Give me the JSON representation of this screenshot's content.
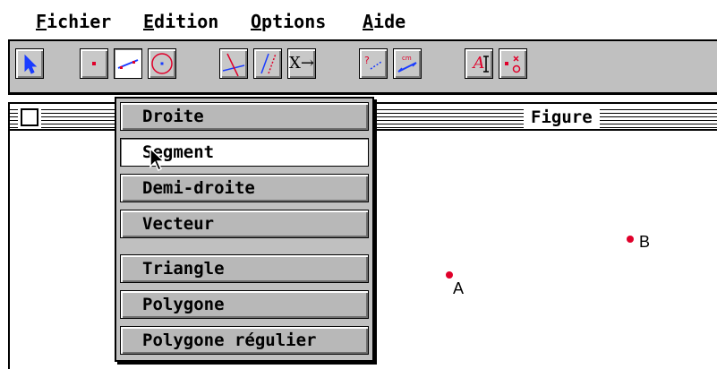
{
  "menubar": {
    "items": [
      {
        "accel": "F",
        "rest": "ichier"
      },
      {
        "accel": "E",
        "rest": "dition"
      },
      {
        "accel": "O",
        "rest": "ptions"
      },
      {
        "accel": "A",
        "rest": "ide"
      }
    ]
  },
  "toolbar": {
    "tools": [
      {
        "name": "pointer",
        "icon": "arrow-pointer-icon"
      },
      {
        "name": "point",
        "icon": "point-icon"
      },
      {
        "name": "line",
        "icon": "line-icon",
        "pressed": true
      },
      {
        "name": "circle",
        "icon": "circle-icon"
      },
      {
        "name": "perpendicular",
        "icon": "perpendicular-icon"
      },
      {
        "name": "parallel",
        "icon": "parallel-icon"
      },
      {
        "name": "transform",
        "icon": "transform-icon",
        "text": "X→"
      },
      {
        "name": "measure",
        "icon": "measure-icon"
      },
      {
        "name": "distance",
        "icon": "distance-icon"
      },
      {
        "name": "text",
        "icon": "text-icon",
        "text": "A"
      },
      {
        "name": "delete",
        "icon": "delete-icon"
      }
    ]
  },
  "window": {
    "title": "Figure"
  },
  "dropdown": {
    "items": [
      "Droite",
      "Segment",
      "Demi-droite",
      "Vecteur",
      "Triangle",
      "Polygone",
      "Polygone régulier"
    ],
    "highlighted_index": 1
  },
  "points": [
    {
      "label": "A"
    },
    {
      "label": "B"
    }
  ],
  "colors": {
    "accent_red": "#e0002a",
    "tool_blue": "#1a3cff",
    "toolbar_gray": "#c0c0c0"
  }
}
